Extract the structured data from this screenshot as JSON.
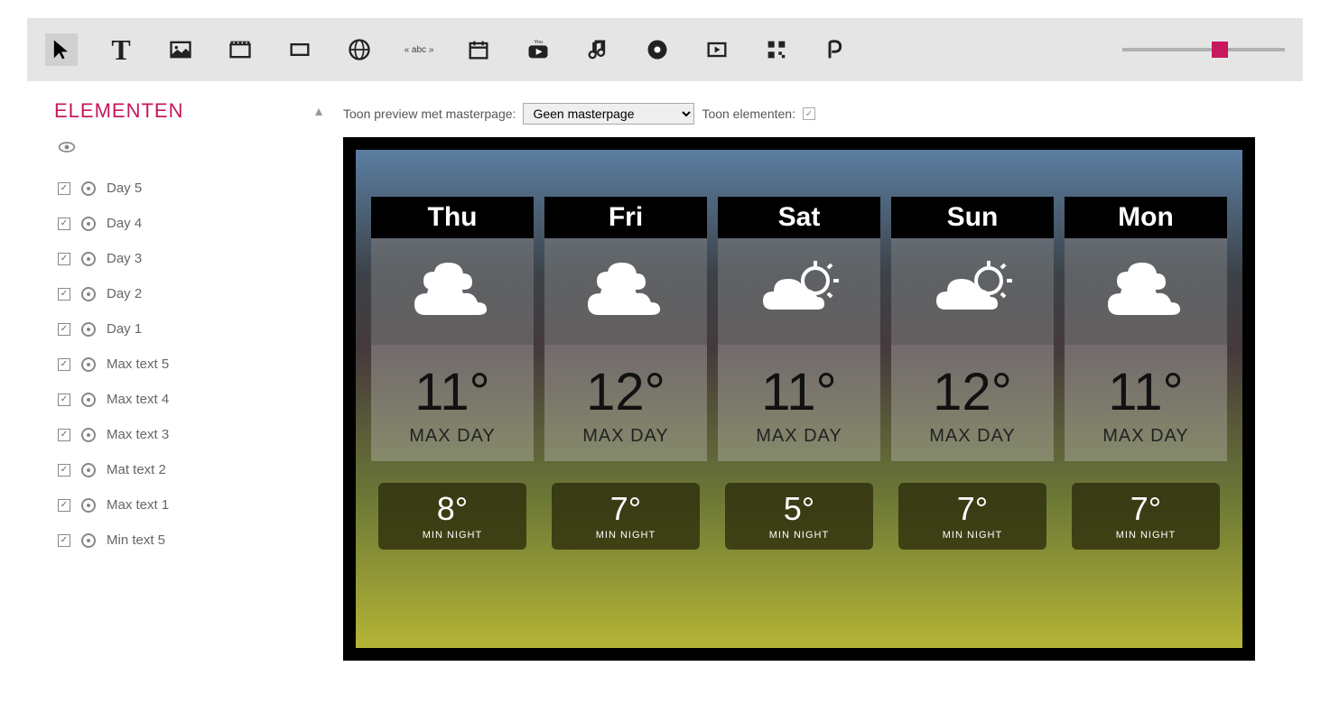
{
  "toolbar": {
    "icons": [
      "cursor",
      "text",
      "image",
      "video",
      "rectangle",
      "web",
      "textline",
      "calendar",
      "youtube",
      "music",
      "disc",
      "presentation",
      "qr",
      "logo"
    ]
  },
  "sidebar": {
    "title": "ELEMENTEN",
    "items": [
      {
        "label": "Day 5"
      },
      {
        "label": "Day 4"
      },
      {
        "label": "Day 3"
      },
      {
        "label": "Day 2"
      },
      {
        "label": "Day 1"
      },
      {
        "label": "Max text 5"
      },
      {
        "label": "Max text 4"
      },
      {
        "label": "Max text 3"
      },
      {
        "label": "Mat text 2"
      },
      {
        "label": "Max text 1"
      },
      {
        "label": "Min text 5"
      }
    ]
  },
  "previewBar": {
    "label": "Toon preview met masterpage:",
    "select": "Geen masterpage",
    "showElements": "Toon elementen:"
  },
  "weather": {
    "maxLabel": "MAX DAY",
    "minLabel": "MIN NIGHT",
    "days": [
      {
        "name": "Thu",
        "icon": "cloud",
        "max": "11°",
        "min": "8°"
      },
      {
        "name": "Fri",
        "icon": "cloud",
        "max": "12°",
        "min": "7°"
      },
      {
        "name": "Sat",
        "icon": "suncloud",
        "max": "11°",
        "min": "5°"
      },
      {
        "name": "Sun",
        "icon": "suncloud",
        "max": "12°",
        "min": "7°"
      },
      {
        "name": "Mon",
        "icon": "cloud",
        "max": "11°",
        "min": "7°"
      }
    ]
  }
}
